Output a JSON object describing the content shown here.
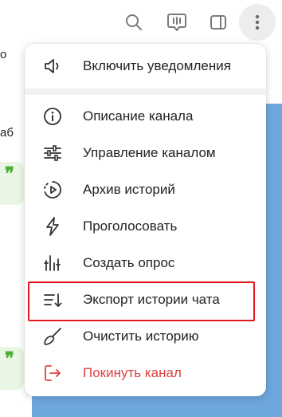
{
  "toolbar": {
    "search_icon": "search-icon",
    "livechat_icon": "live-chat-icon",
    "panel_icon": "side-panel-icon",
    "more_icon": "more-vertical-icon"
  },
  "background_chat": {
    "fragments": [
      "о",
      "аб"
    ],
    "quote_glyph": "❞"
  },
  "menu": {
    "items": [
      {
        "label": "Включить уведомления",
        "icon": "speaker-icon"
      },
      {
        "label": "Описание канала",
        "icon": "info-icon"
      },
      {
        "label": "Управление каналом",
        "icon": "sliders-icon"
      },
      {
        "label": "Архив историй",
        "icon": "story-archive-icon"
      },
      {
        "label": "Проголосовать",
        "icon": "boost-icon"
      },
      {
        "label": "Создать опрос",
        "icon": "poll-icon"
      },
      {
        "label": "Экспорт истории чата",
        "icon": "export-icon"
      },
      {
        "label": "Очистить историю",
        "icon": "broom-icon"
      },
      {
        "label": "Покинуть канал",
        "icon": "leave-icon"
      }
    ]
  },
  "colors": {
    "accent_danger": "#df3f40",
    "highlight_border": "#e3191e",
    "chat_background": "#6ea7de",
    "quote_green": "#4fae33"
  }
}
